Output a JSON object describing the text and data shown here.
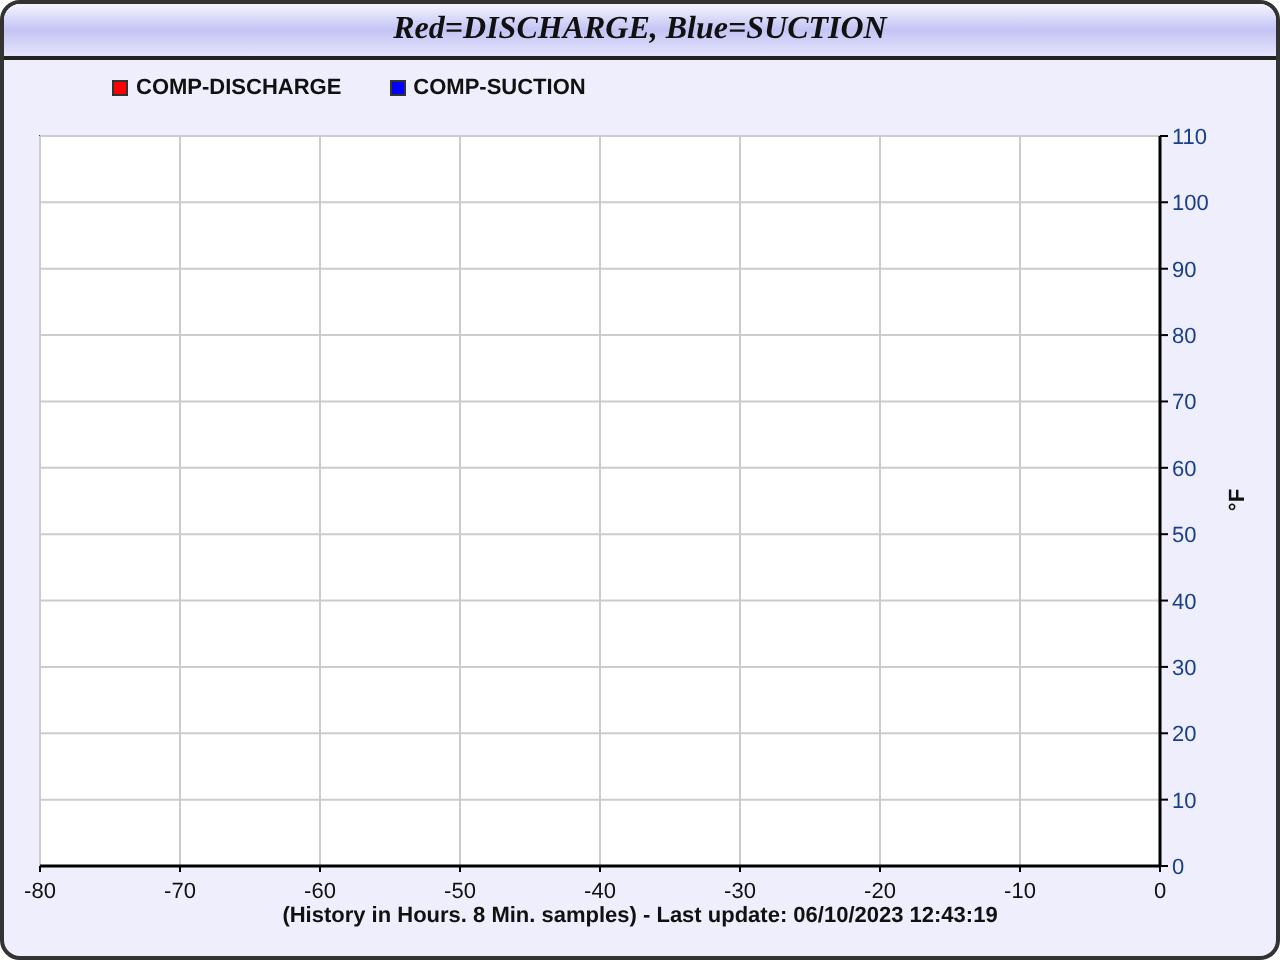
{
  "window": {
    "title": "Red=DISCHARGE, Blue=SUCTION"
  },
  "chart": {
    "chart_data": {
      "type": "line",
      "xlabel": "(History in Hours. 8 Min. samples) - Last update: 06/10/2023 12:43:19",
      "ylabel": "°F",
      "grid": true,
      "categories": [
        "-80",
        "-70",
        "-60",
        "-50",
        "-40",
        "-30",
        "-20",
        "-10",
        "0"
      ],
      "series": [
        {
          "name": "COMP-DISCHARGE",
          "color": "#ff0000",
          "values": [
            null,
            null,
            null,
            null,
            null,
            null,
            null,
            null,
            null
          ]
        },
        {
          "name": "COMP-SUCTION",
          "color": "#0000ff",
          "values": [
            null,
            null,
            null,
            null,
            null,
            null,
            null,
            null,
            null
          ]
        }
      ],
      "ylim": [
        0,
        110
      ],
      "yticks": [
        0,
        10,
        20,
        30,
        40,
        50,
        60,
        70,
        80,
        90,
        100,
        110
      ]
    }
  }
}
